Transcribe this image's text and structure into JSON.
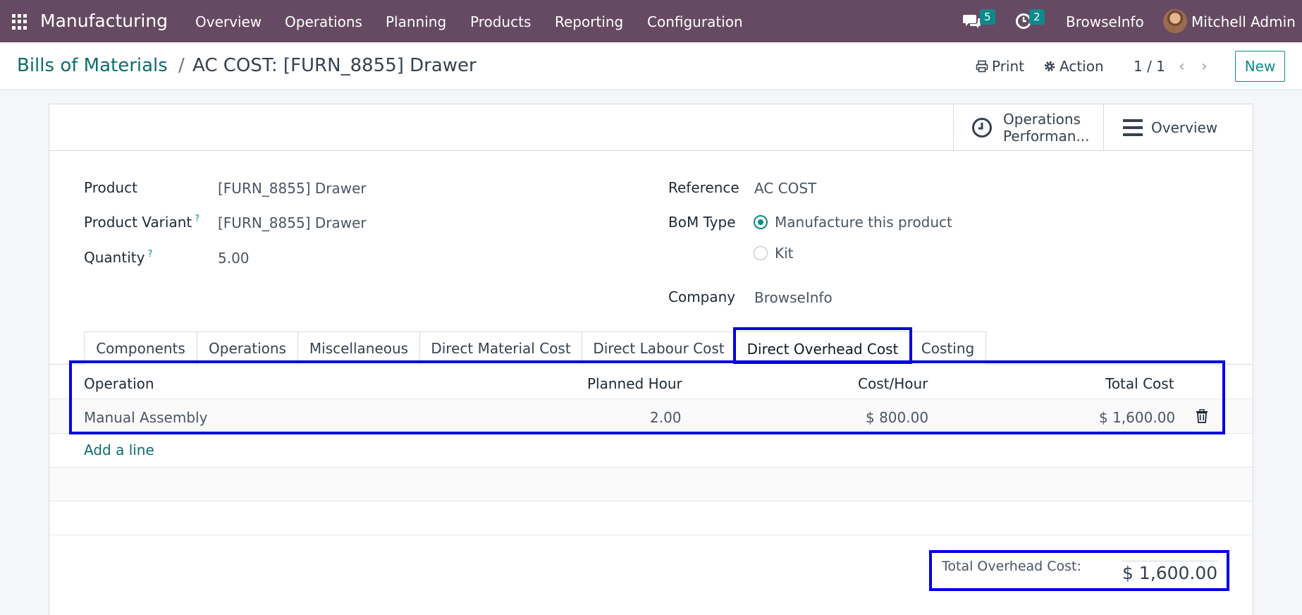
{
  "topnav": {
    "app_title": "Manufacturing",
    "menu": [
      "Overview",
      "Operations",
      "Planning",
      "Products",
      "Reporting",
      "Configuration"
    ],
    "messages_count": "5",
    "activities_count": "2",
    "company": "BrowseInfo",
    "user": "Mitchell Admin"
  },
  "control": {
    "breadcrumb_parent": "Bills of Materials",
    "breadcrumb_sep": "/",
    "breadcrumb_current": "AC COST: [FURN_8855] Drawer",
    "print_label": "Print",
    "action_label": "Action",
    "pager": "1 / 1",
    "new_label": "New"
  },
  "smart_buttons": {
    "operations_perf_line1": "Operations",
    "operations_perf_line2": "Performan...",
    "overview": "Overview"
  },
  "form": {
    "product_label": "Product",
    "product_value": "[FURN_8855] Drawer",
    "variant_label": "Product Variant",
    "variant_value": "[FURN_8855] Drawer",
    "quantity_label": "Quantity",
    "quantity_value": "5.00",
    "help_mark": "?",
    "reference_label": "Reference",
    "reference_value": "AC COST",
    "bom_type_label": "BoM Type",
    "bom_type_options": [
      "Manufacture this product",
      "Kit"
    ],
    "bom_type_selected": "Manufacture this product",
    "company_label": "Company",
    "company_value": "BrowseInfo"
  },
  "tabs": [
    "Components",
    "Operations",
    "Miscellaneous",
    "Direct Material Cost",
    "Direct Labour Cost",
    "Direct Overhead Cost",
    "Costing"
  ],
  "active_tab": "Direct Overhead Cost",
  "table": {
    "columns": [
      "Operation",
      "Planned Hour",
      "Cost/Hour",
      "Total Cost"
    ],
    "rows": [
      {
        "operation": "Manual Assembly",
        "planned_hour": "2.00",
        "cost_hour": "$ 800.00",
        "total_cost": "$ 1,600.00"
      }
    ],
    "add_line": "Add a line"
  },
  "totals": {
    "label": "Total Overhead Cost:",
    "value": "$ 1,600.00"
  },
  "colors": {
    "navbar": "#664a63",
    "accent": "#0e8a8a",
    "highlight": "#0000e0"
  }
}
